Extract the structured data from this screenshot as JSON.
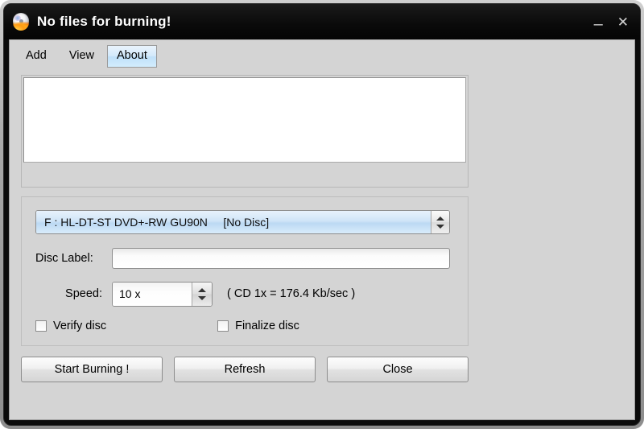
{
  "window": {
    "title": "No files for burning!",
    "icon": "burning-cd-icon",
    "controls": {
      "minimize_label": "–",
      "close_label": "✕"
    }
  },
  "menu": {
    "items": [
      {
        "label": "Add",
        "active": false
      },
      {
        "label": "View",
        "active": false
      },
      {
        "label": "About",
        "active": true
      }
    ]
  },
  "file_list": {
    "items": [],
    "status_text": ""
  },
  "settings": {
    "drive": {
      "selected": "F : HL-DT-ST DVD+-RW GU90N     [No Disc]",
      "drive_letter": "F",
      "drive_model": "HL-DT-ST DVD+-RW GU90N",
      "disc_status": "[No Disc]"
    },
    "disc_label": {
      "caption": "Disc Label:",
      "value": "",
      "placeholder": ""
    },
    "speed": {
      "caption": "Speed:",
      "selected": "10 x",
      "note": "( CD 1x = 176.4 Kb/sec )"
    },
    "verify_disc": {
      "label": "Verify disc",
      "checked": false
    },
    "finalize_disc": {
      "label": "Finalize disc",
      "checked": false
    }
  },
  "buttons": {
    "start": "Start Burning !",
    "refresh": "Refresh",
    "close": "Close"
  },
  "colors": {
    "titlebar_bg": "#0a0a0a",
    "titlebar_text": "#ffffff",
    "client_bg": "#d4d4d4",
    "menu_active_bg": "#cfe6fa",
    "combo_selected_bg": "#cfe4f7",
    "list_bg": "#ffffff"
  }
}
